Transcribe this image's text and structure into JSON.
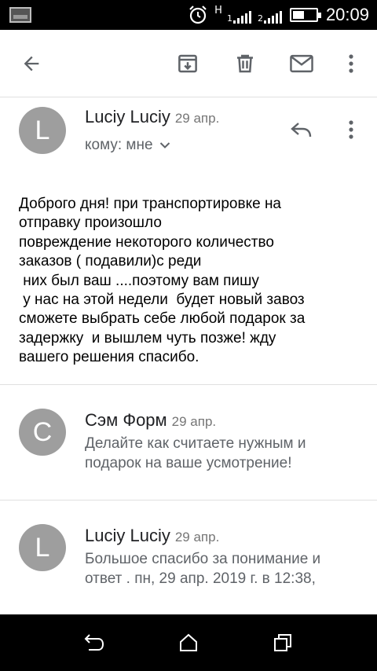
{
  "status_bar": {
    "time": "20:09",
    "sim1_label": "1",
    "sim2_label": "2",
    "network_type": "H",
    "icons": [
      "screenshot-thumbnail-icon",
      "alarm-icon",
      "signal-icon",
      "battery-icon"
    ]
  },
  "toolbar": {
    "icons": [
      "back-arrow-icon",
      "archive-icon",
      "delete-icon",
      "mail-icon",
      "more-vert-icon"
    ]
  },
  "messages": [
    {
      "avatar_letter": "L",
      "sender": "Luciy Luciy",
      "date": "29 апр.",
      "recipient_label": "кому: мне",
      "body": "Доброго дня! при транспортировке на\nотправку произошло\nповреждение некоторого количество\nзаказов ( подавили)с реди\n них был ваш ....поэтому вам пишу\n у нас на этой недели  будет новый завоз\nсможете выбрать себе любой подарок за\nзадержку  и вышлем чуть позже! жду\nвашего решения спасибо."
    },
    {
      "avatar_letter": "C",
      "sender": "Сэм Форм",
      "date": "29 апр.",
      "snippet_line1": "Делайте как считаете нужным и",
      "snippet_line2": "подарок на ваше усмотрение!"
    },
    {
      "avatar_letter": "L",
      "sender": "Luciy Luciy",
      "date": "29 апр.",
      "snippet_line1": "Большое спасибо за понимание и",
      "snippet_line2": "ответ . пн, 29 апр. 2019 г. в 12:38,"
    }
  ],
  "nav_bar": {
    "icons": [
      "nav-back-icon",
      "nav-home-icon",
      "nav-recents-icon"
    ]
  },
  "colors": {
    "avatar": "#9e9e9e",
    "icon": "#5f6368",
    "secondary_text": "#5f6368"
  }
}
